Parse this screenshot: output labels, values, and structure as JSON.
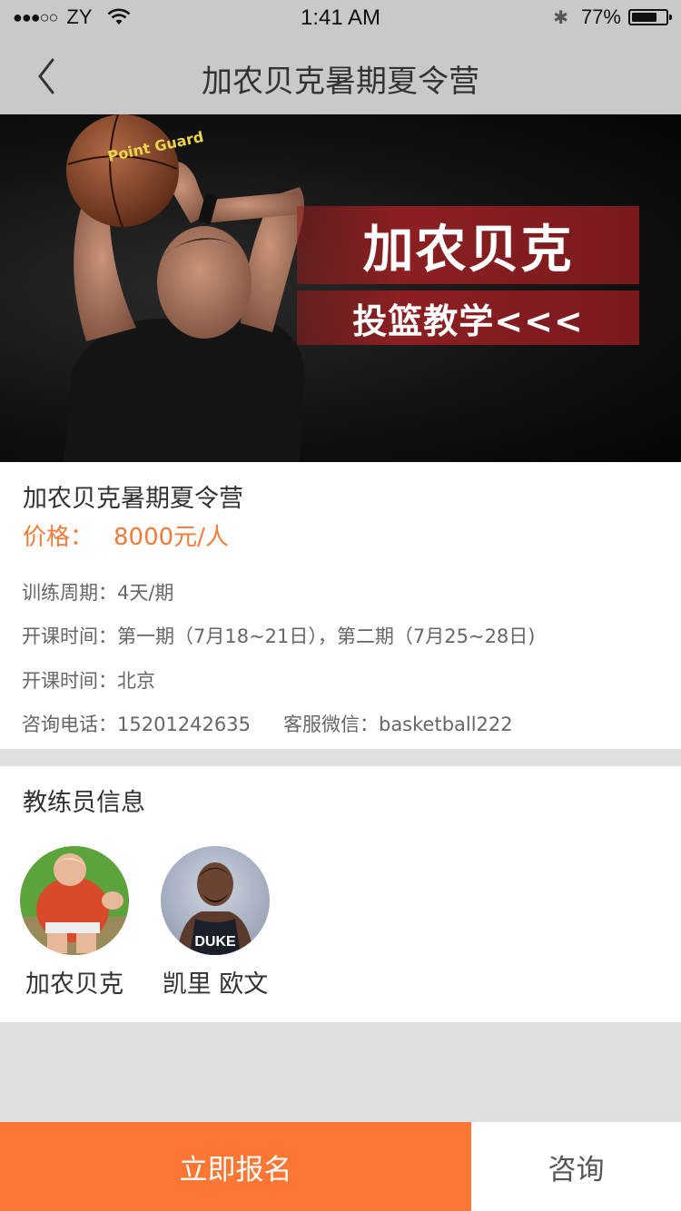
{
  "status_bar": {
    "signal_dots": "●●●○○",
    "carrier": "ZY",
    "time": "1:41 AM",
    "bluetooth_glyph": "✱",
    "battery": "77%",
    "battery_level": 0.77
  },
  "nav": {
    "title": "加农贝克暑期夏令营",
    "back_icon": "chevron-left-icon"
  },
  "hero": {
    "banner_line1": "加农贝克",
    "banner_line2": "投篮教学<<<",
    "ball_text": "Point Guard"
  },
  "info": {
    "title": "加农贝克暑期夏令营",
    "price_label": "价格：",
    "price_value": "8000元/人",
    "period": "训练周期：4天/期",
    "schedule": "开课时间：第一期（7月18~21日），第二期（7月25~28日)",
    "location": "开课时间：北京",
    "phone": "咨询电话：15201242635",
    "wechat": "客服微信：basketball222"
  },
  "coaches": {
    "title": "教练员信息",
    "items": [
      {
        "name": "加农贝克"
      },
      {
        "name": "凯里 欧文"
      }
    ]
  },
  "actions": {
    "signup": "立即报名",
    "consult": "咨询"
  },
  "colors": {
    "accent": "#fd7634",
    "price": "#f47a3a",
    "banner_red": "#8c1f22",
    "header_gray": "#c9c9c9"
  }
}
